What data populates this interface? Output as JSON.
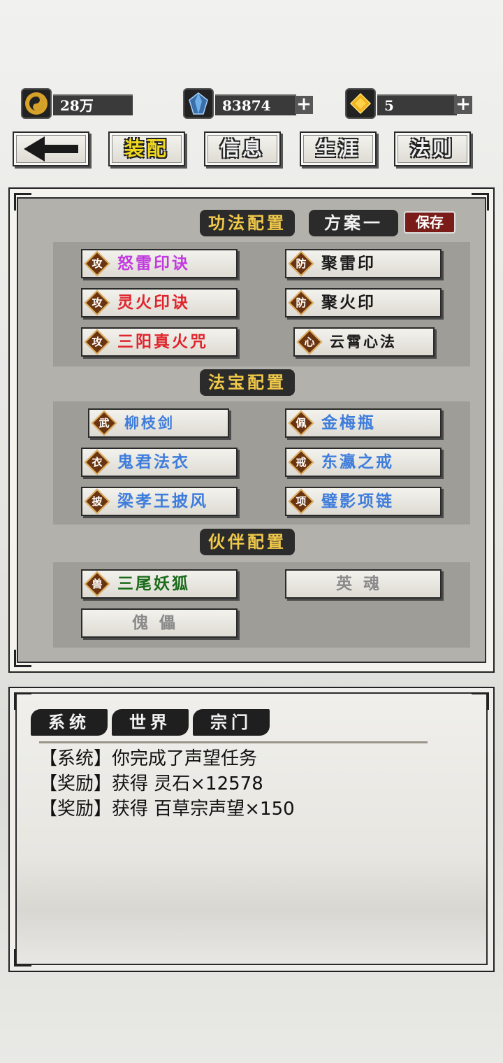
{
  "resources": {
    "taiji": {
      "value": "28万",
      "icon": "taiji-coin-icon"
    },
    "crystal": {
      "value": "83874",
      "icon": "blue-crystal-icon"
    },
    "gold": {
      "value": "5",
      "icon": "gold-gem-icon"
    }
  },
  "nav": {
    "back_icon": "back-arrow-icon",
    "tabs": [
      "装配",
      "信息",
      "生涯",
      "法则"
    ],
    "active": "装配"
  },
  "panel": {
    "gongfa": {
      "title": "功法配置",
      "scheme": "方案一",
      "save": "保存",
      "left": [
        {
          "badge": "攻",
          "name": "怒雷印诀",
          "color": "#c13adf"
        },
        {
          "badge": "攻",
          "name": "灵火印诀",
          "color": "#e0242c"
        },
        {
          "badge": "攻",
          "name": "三阳真火咒",
          "color": "#e0242c"
        }
      ],
      "right": [
        {
          "badge": "防",
          "name": "聚雷印",
          "color": "#1a1a1a"
        },
        {
          "badge": "防",
          "name": "聚火印",
          "color": "#1a1a1a"
        },
        {
          "badge": "心",
          "name": "云霄心法",
          "color": "#1a1a1a"
        }
      ]
    },
    "fabao": {
      "title": "法宝配置",
      "left": [
        {
          "badge": "武",
          "name": "柳枝剑"
        },
        {
          "badge": "衣",
          "name": "鬼君法衣"
        },
        {
          "badge": "披",
          "name": "梁孝王披风"
        }
      ],
      "right": [
        {
          "badge": "佩",
          "name": "金梅瓶"
        },
        {
          "badge": "戒",
          "name": "东瀛之戒"
        },
        {
          "badge": "项",
          "name": "璧影项链"
        }
      ]
    },
    "huoban": {
      "title": "伙伴配置",
      "pet": {
        "badge": "兽",
        "name": "三尾妖狐"
      },
      "spirit_empty": "英魂",
      "puppet_empty": "傀儡"
    }
  },
  "chat": {
    "tabs": [
      "系统",
      "世界",
      "宗门"
    ],
    "messages": [
      "【系统】你完成了声望任务",
      "【奖励】获得 灵石×12578",
      "【奖励】获得 百草宗声望×150"
    ]
  }
}
